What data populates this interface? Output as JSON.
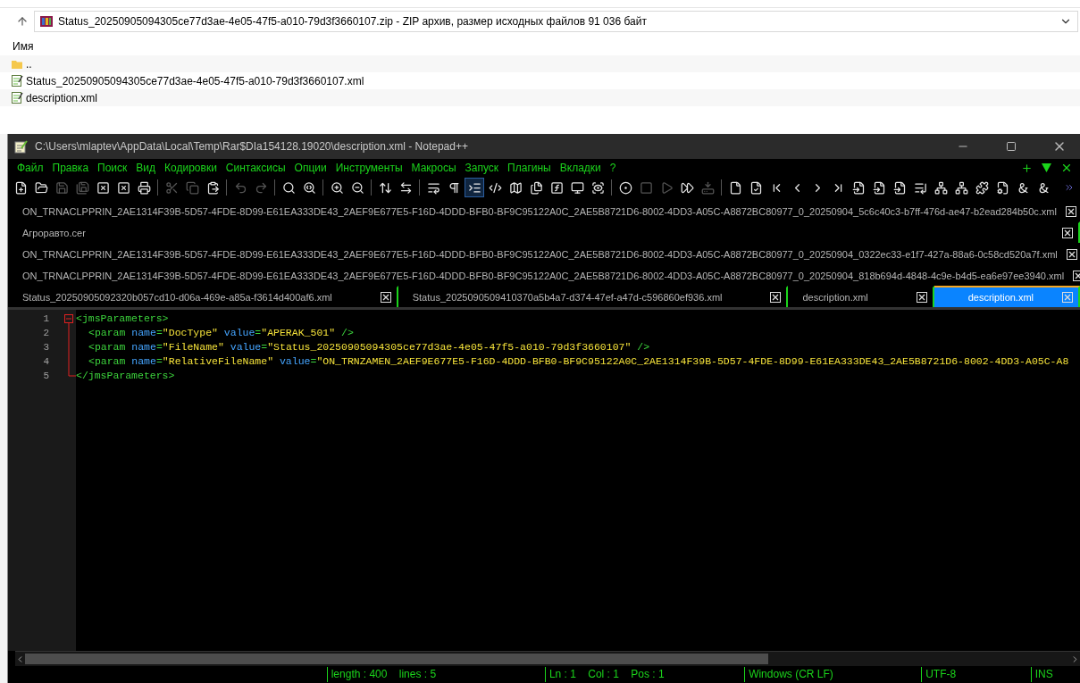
{
  "archive": {
    "address": "Status_20250905094305ce77d3ae-4e05-47f5-a010-79d3f3660107.zip - ZIP архив, размер исходных файлов 91 036 байт",
    "column": "Имя",
    "files": [
      {
        "kind": "folder",
        "name": ".."
      },
      {
        "kind": "file",
        "name": "Status_20250905094305ce77d3ae-4e05-47f5-a010-79d3f3660107.xml"
      },
      {
        "kind": "file",
        "name": "description.xml"
      }
    ]
  },
  "window": {
    "title": "C:\\Users\\mlaptev\\AppData\\Local\\Temp\\Rar$DIa154128.19020\\description.xml - Notepad++"
  },
  "menu": [
    "Файл",
    "Правка",
    "Поиск",
    "Вид",
    "Кодировки",
    "Синтаксисы",
    "Опции",
    "Инструменты",
    "Макросы",
    "Запуск",
    "Плагины",
    "Вкладки",
    "?"
  ],
  "toolbar": [
    {
      "kind": "new",
      "disabled": false
    },
    {
      "kind": "open",
      "disabled": false
    },
    {
      "kind": "save",
      "disabled": true
    },
    {
      "kind": "save-all",
      "disabled": true
    },
    {
      "kind": "close",
      "disabled": false
    },
    {
      "kind": "close-all",
      "disabled": false
    },
    {
      "kind": "print",
      "disabled": false
    },
    {
      "kind": "sep"
    },
    {
      "kind": "cut",
      "disabled": true
    },
    {
      "kind": "copy",
      "disabled": true
    },
    {
      "kind": "paste",
      "disabled": false
    },
    {
      "kind": "sep"
    },
    {
      "kind": "undo",
      "disabled": true
    },
    {
      "kind": "redo",
      "disabled": true
    },
    {
      "kind": "sep"
    },
    {
      "kind": "find",
      "disabled": false
    },
    {
      "kind": "replace",
      "disabled": false
    },
    {
      "kind": "sep"
    },
    {
      "kind": "zoom-in",
      "disabled": false
    },
    {
      "kind": "zoom-out",
      "disabled": false
    },
    {
      "kind": "sep"
    },
    {
      "kind": "sync-v",
      "disabled": false
    },
    {
      "kind": "sync-h",
      "disabled": false
    },
    {
      "kind": "sep"
    },
    {
      "kind": "wrap",
      "disabled": false
    },
    {
      "kind": "pilcrow",
      "disabled": false
    },
    {
      "kind": "indent",
      "disabled": false,
      "selected": true
    },
    {
      "kind": "code",
      "disabled": false
    },
    {
      "kind": "map",
      "disabled": false
    },
    {
      "kind": "docs",
      "disabled": false
    },
    {
      "kind": "function",
      "disabled": false
    },
    {
      "kind": "monitor",
      "disabled": false
    },
    {
      "kind": "eye",
      "disabled": false
    },
    {
      "kind": "sep"
    },
    {
      "kind": "record",
      "disabled": false
    },
    {
      "kind": "stop",
      "disabled": true
    },
    {
      "kind": "play",
      "disabled": true
    },
    {
      "kind": "play-multi",
      "disabled": false
    },
    {
      "kind": "save-macro",
      "disabled": true
    },
    {
      "kind": "sep"
    },
    {
      "kind": "file",
      "disabled": false
    },
    {
      "kind": "file-check",
      "disabled": false
    },
    {
      "kind": "first",
      "disabled": false
    },
    {
      "kind": "prev",
      "disabled": false
    },
    {
      "kind": "next",
      "disabled": false
    },
    {
      "kind": "last",
      "disabled": false
    },
    {
      "kind": "import",
      "disabled": false
    },
    {
      "kind": "import",
      "disabled": false
    },
    {
      "kind": "import",
      "disabled": false
    },
    {
      "kind": "list",
      "disabled": false
    },
    {
      "kind": "tree",
      "disabled": false
    },
    {
      "kind": "tree",
      "disabled": false
    },
    {
      "kind": "puzzle",
      "disabled": false
    },
    {
      "kind": "file-cog",
      "disabled": false
    },
    {
      "kind": "amp",
      "disabled": false
    },
    {
      "kind": "amp",
      "disabled": false
    }
  ],
  "tab_rows": [
    [
      {
        "label": "ON_TRNACLPPRIN_2AE1314F39B-5D57-4FDE-8D99-E61EA333DE43_2AEF9E677E5-F16D-4DDD-BFB0-BF9C95122A0C_2AE5B8721D6-8002-4DD3-A05C-A8872BC80977_0_20250904_5c6c40c3-b7ff-476d-ae47-b2ead284b50c.xml",
        "selected": false
      }
    ],
    [
      {
        "label": "Агроравто.cer",
        "selected": false
      }
    ],
    [
      {
        "label": "ON_TRNACLPPRIN_2AE1314F39B-5D57-4FDE-8D99-E61EA333DE43_2AEF9E677E5-F16D-4DDD-BFB0-BF9C95122A0C_2AE5B8721D6-8002-4DD3-A05C-A8872BC80977_0_20250904_0322ec33-e1f7-427a-88a6-0c58cd520a7f.xml",
        "selected": false
      }
    ],
    [
      {
        "label": "ON_TRNACLPPRIN_2AE1314F39B-5D57-4FDE-8D99-E61EA333DE43_2AEF9E677E5-F16D-4DDD-BFB0-BF9C95122A0C_2AE5B8721D6-8002-4DD3-A05C-A8872BC80977_0_20250904_818b694d-4848-4c9e-b4d5-ea6e97ee3940.xml",
        "selected": false
      }
    ],
    [
      {
        "label": "Status_20250905092320b057cd10-d06a-469e-a85a-f3614d400af6.xml",
        "selected": false
      },
      {
        "label": "Status_2025090509410370a5b4a7-d374-47ef-a47d-c596860ef936.xml",
        "selected": false
      },
      {
        "label": "description.xml",
        "selected": false
      },
      {
        "label": "description.xml",
        "selected": true
      }
    ]
  ],
  "editor": {
    "lines": [
      {
        "number": "1",
        "tokens": [
          {
            "kind": "tag",
            "text": "<jmsParameters>"
          }
        ]
      },
      {
        "number": "2",
        "indented": true,
        "tokens": [
          {
            "kind": "tag",
            "text": "<param "
          },
          {
            "kind": "attr",
            "text": "name"
          },
          {
            "kind": "tag",
            "text": "="
          },
          {
            "kind": "value",
            "text": "\"DocType\" "
          },
          {
            "kind": "attr",
            "text": "value"
          },
          {
            "kind": "tag",
            "text": "="
          },
          {
            "kind": "value",
            "text": "\"APERAK_501\" "
          },
          {
            "kind": "tag",
            "text": "/>"
          }
        ]
      },
      {
        "number": "3",
        "indented": true,
        "tokens": [
          {
            "kind": "tag",
            "text": "<param "
          },
          {
            "kind": "attr",
            "text": "name"
          },
          {
            "kind": "tag",
            "text": "="
          },
          {
            "kind": "value",
            "text": "\"FileName\" "
          },
          {
            "kind": "attr",
            "text": "value"
          },
          {
            "kind": "tag",
            "text": "="
          },
          {
            "kind": "value",
            "text": "\"Status_20250905094305ce77d3ae-4e05-47f5-a010-79d3f3660107\" "
          },
          {
            "kind": "tag",
            "text": "/>"
          }
        ]
      },
      {
        "number": "4",
        "indented": true,
        "tokens": [
          {
            "kind": "tag",
            "text": "<param "
          },
          {
            "kind": "attr",
            "text": "name"
          },
          {
            "kind": "tag",
            "text": "="
          },
          {
            "kind": "value",
            "text": "\"RelativeFileName\" "
          },
          {
            "kind": "attr",
            "text": "value"
          },
          {
            "kind": "tag",
            "text": "="
          },
          {
            "kind": "value",
            "text": "\"ON_TRNZAMEN_2AEF9E677E5-F16D-4DDD-BFB0-BF9C95122A0C_2AE1314F39B-5D57-4FDE-8D99-E61EA333DE43_2AE5B8721D6-8002-4DD3-A05C-A8"
          }
        ]
      },
      {
        "number": "5",
        "tokens": [
          {
            "kind": "tag",
            "text": "</jmsParameters>"
          }
        ]
      }
    ]
  },
  "status_bar": [
    "length : 400    lines : 5",
    "Ln : 1    Col : 1    Pos : 1",
    "Windows (CR LF)",
    "UTF-8",
    "INS"
  ]
}
